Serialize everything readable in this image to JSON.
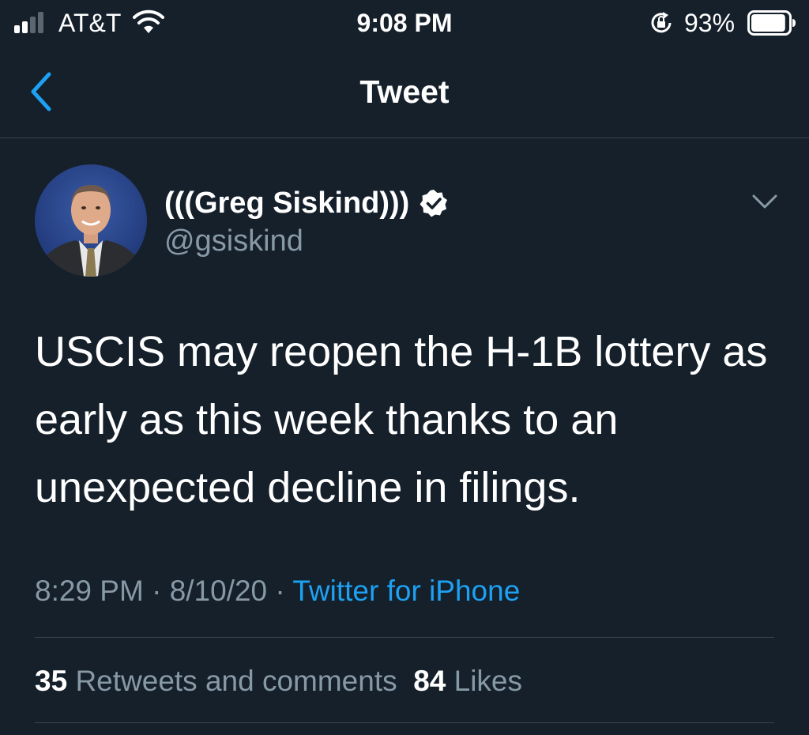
{
  "status_bar": {
    "carrier": "AT&T",
    "time": "9:08 PM",
    "battery_percent": "93%",
    "battery_level": 0.93,
    "signal_bars_active": 2,
    "signal_bars_total": 4,
    "icons": [
      "signal-icon",
      "wifi-icon",
      "rotation-lock-icon",
      "battery-icon"
    ]
  },
  "nav": {
    "title": "Tweet",
    "back_icon": "chevron-left-icon"
  },
  "tweet": {
    "display_name": "(((Greg Siskind)))",
    "handle": "@gsiskind",
    "verified": true,
    "text": "USCIS may reopen the H-1B lottery as early as this week thanks to an unexpected decline in filings.",
    "time": "8:29 PM",
    "date": "8/10/20",
    "separator": "·",
    "source": "Twitter for iPhone",
    "retweets_count": "35",
    "retweets_label": "Retweets and comments",
    "likes_count": "84",
    "likes_label": "Likes"
  },
  "colors": {
    "background": "#15202b",
    "accent": "#1da1f2",
    "secondary_text": "#8899a6",
    "divider": "#38444d"
  }
}
